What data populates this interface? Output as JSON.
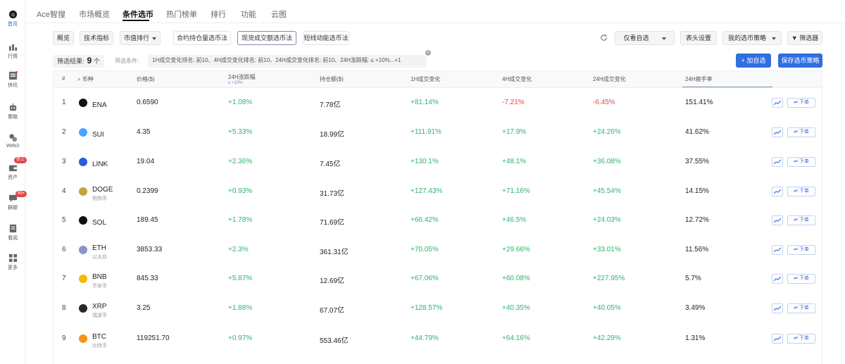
{
  "sidebar": {
    "items": [
      {
        "label": "首页",
        "icon": "home-icon",
        "active": true
      },
      {
        "label": "行情",
        "icon": "market-icon"
      },
      {
        "label": "快讯",
        "icon": "news-icon"
      },
      {
        "label": "策略",
        "icon": "strategy-icon"
      },
      {
        "label": "Web3",
        "icon": "web3-icon"
      },
      {
        "label": "资产",
        "icon": "wallet-icon",
        "badge": "禁上"
      },
      {
        "label": "群聊",
        "icon": "chat-icon",
        "badge": "99+"
      },
      {
        "label": "看阅",
        "icon": "reading-icon"
      },
      {
        "label": "更多",
        "icon": "grid-icon"
      }
    ]
  },
  "nav": {
    "tabs": [
      "Ace智搜",
      "市场概览",
      "条件选币",
      "热门榜单",
      "排行",
      "功能",
      "云图"
    ],
    "active": "条件选币"
  },
  "toolbar": {
    "overview": "概览",
    "tech": "技术指标",
    "rank": "市值排行",
    "contract": "合约持仓量选币法",
    "spot": "现货成交额选币法",
    "shortline": "短线动能选币法",
    "only_watch": "仅看自选",
    "header_settings": "表头设置",
    "my_strategy": "我的选币策略",
    "filter": "筛选器",
    "add_watch": "+ 加自选",
    "save_strategy": "保存选币策略"
  },
  "filter": {
    "result_label": "筛选结果:",
    "result_count": "9",
    "result_unit": "个",
    "cond_label": "筛选条件:",
    "cond_text": "1H成交变化排名: 前10、4H成交变化排名: 前10、24H成交变化排名: 前10、24H涨跌幅: ≤ +10%...+1"
  },
  "table": {
    "headers": {
      "rank": "#",
      "coin": "币种",
      "price": "价格($)",
      "change24h": "24H涨跌幅",
      "change24h_sub": "≤ +10%",
      "oi": "持仓额($)",
      "vol1h": "1H成交变化",
      "vol4h": "4H成交变化",
      "vol24h": "24H成交变化",
      "turnover": "24H换手率"
    },
    "order_label": "⇌ 下单",
    "rows": [
      {
        "rank": "1",
        "symbol": "ENA",
        "sub": "",
        "price": "0.6590",
        "change24h": "+1.08%",
        "oi": "7.78亿",
        "vol1h": "+81.14%",
        "vol4h": "-7.21%",
        "vol24h": "-6.45%",
        "turnover": "151.41%",
        "color": "#111111"
      },
      {
        "rank": "2",
        "symbol": "SUI",
        "sub": "",
        "price": "4.35",
        "change24h": "+5.33%",
        "oi": "18.99亿",
        "vol1h": "+111.91%",
        "vol4h": "+17.9%",
        "vol24h": "+24.26%",
        "turnover": "41.62%",
        "color": "#4ca3ff"
      },
      {
        "rank": "3",
        "symbol": "LINK",
        "sub": "",
        "price": "19.04",
        "change24h": "+2.36%",
        "oi": "7.45亿",
        "vol1h": "+130.1%",
        "vol4h": "+48.1%",
        "vol24h": "+36.08%",
        "turnover": "37.55%",
        "color": "#2a5ada"
      },
      {
        "rank": "4",
        "symbol": "DOGE",
        "sub": "狗狗币",
        "price": "0.2399",
        "change24h": "+0.93%",
        "oi": "31.73亿",
        "vol1h": "+127.43%",
        "vol4h": "+71.16%",
        "vol24h": "+45.54%",
        "turnover": "14.15%",
        "color": "#c2a633"
      },
      {
        "rank": "5",
        "symbol": "SOL",
        "sub": "",
        "price": "189.45",
        "change24h": "+1.78%",
        "oi": "71.69亿",
        "vol1h": "+66.42%",
        "vol4h": "+46.5%",
        "vol24h": "+24.03%",
        "turnover": "12.72%",
        "color": "#111111"
      },
      {
        "rank": "6",
        "symbol": "ETH",
        "sub": "以太坊",
        "price": "3853.33",
        "change24h": "+2.3%",
        "oi": "361.31亿",
        "vol1h": "+70.05%",
        "vol4h": "+29.66%",
        "vol24h": "+33.01%",
        "turnover": "11.56%",
        "color": "#8b94c9"
      },
      {
        "rank": "7",
        "symbol": "BNB",
        "sub": "币安币",
        "price": "845.33",
        "change24h": "+5.87%",
        "oi": "12.69亿",
        "vol1h": "+67.06%",
        "vol4h": "+60.08%",
        "vol24h": "+227.95%",
        "turnover": "5.7%",
        "color": "#f0b90b"
      },
      {
        "rank": "8",
        "symbol": "XRP",
        "sub": "瑞波币",
        "price": "3.25",
        "change24h": "+1.88%",
        "oi": "67.07亿",
        "vol1h": "+128.57%",
        "vol4h": "+40.35%",
        "vol24h": "+40.05%",
        "turnover": "3.49%",
        "color": "#23292f"
      },
      {
        "rank": "9",
        "symbol": "BTC",
        "sub": "比特币",
        "price": "119251.70",
        "change24h": "+0.97%",
        "oi": "553.46亿",
        "vol1h": "+44.79%",
        "vol4h": "+64.16%",
        "vol24h": "+42.29%",
        "turnover": "1.31%",
        "color": "#f7931a"
      }
    ]
  }
}
